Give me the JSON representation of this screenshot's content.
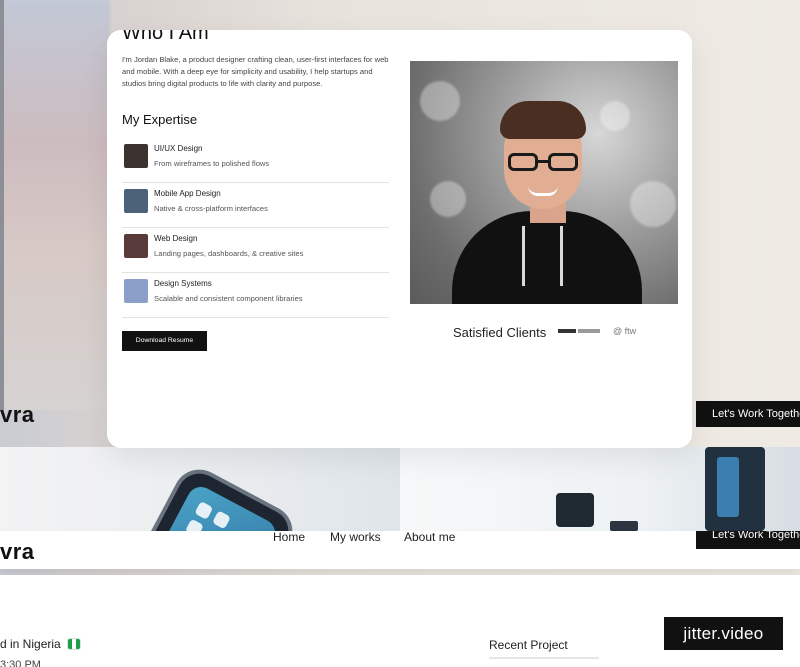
{
  "about": {
    "title": "Who I Am",
    "bio": "I'm Jordan Blake, a product designer crafting clean, user-first interfaces for web and mobile. With a deep eye for simplicity and usability, I help startups and studios bring digital products to life with clarity and purpose.",
    "expertise_title": "My Expertise",
    "expertise": [
      {
        "title": "UI/UX Design",
        "desc": "From wireframes to polished flows",
        "thumb": "#3a3330"
      },
      {
        "title": "Mobile App Design",
        "desc": "Native & cross-platform interfaces",
        "thumb": "#4b6278"
      },
      {
        "title": "Web Design",
        "desc": "Landing pages, dashboards, & creative sites",
        "thumb": "#5a3b3b"
      },
      {
        "title": "Design Systems",
        "desc": "Scalable and consistent component libraries",
        "thumb": "#8aa0c8"
      }
    ],
    "download_label": "Download Resume",
    "clients_label": "Satisfied Clients",
    "client_2": "@ ftw"
  },
  "nav": {
    "logo": "vra",
    "links": [
      "Home",
      "My works",
      "About me"
    ],
    "cta": "Let's Work Together"
  },
  "footer": {
    "location": "d in Nigeria",
    "time": "3:30 PM",
    "recent_project": "Recent Project"
  },
  "watermark": "jitter.video",
  "colors": {
    "accent": "#111111",
    "card": "#ffffff",
    "flag_green": "#1e9e4d"
  }
}
